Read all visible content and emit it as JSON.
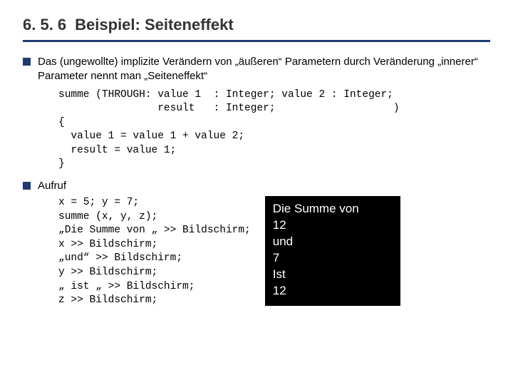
{
  "section_number": "6. 5. 6",
  "section_title": "Beispiel: Seiteneffekt",
  "bullets": {
    "b1": "Das (ungewollte)  implizite Verändern von „äußeren“ Parametern durch Veränderung „innerer“ Parameter nennt man „Seiteneffekt“",
    "b2": "Aufruf"
  },
  "code_def": "summe (THROUGH: value 1  : Integer; value 2 : Integer;\n                result   : Integer;                   )\n{\n  value 1 = value 1 + value 2;\n  result = value 1;\n}",
  "code_call": "x = 5; y = 7;\nsumme (x, y, z);\n„Die Summe von „ >> Bildschirm;\nx >> Bildschirm;\n„und“ >> Bildschirm;\ny >> Bildschirm;\n„ ist „ >> Bildschirm;\nz >> Bildschirm;",
  "output": "Die Summe von\n12\nund\n7\nIst\n12"
}
